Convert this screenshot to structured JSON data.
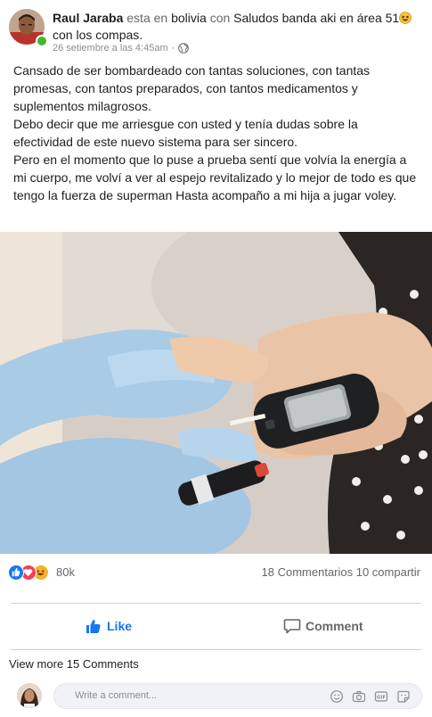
{
  "post": {
    "author": "Raul Jaraba",
    "location_connector": "esta en",
    "location": "bolivia",
    "with_connector": "con",
    "activity_line": "Saludos banda aki en área 51",
    "activity_tail": "con los compas.",
    "timestamp": "26 setiembre a las 4:45am",
    "dot": "·",
    "paragraphs": [
      "Cansado de ser bombardeado con tantas soluciones, con tantas promesas, con tantos preparados, con tantos medicamentos y suplementos milagrosos.",
      "Debo decir que me arriesgue con usted y tenía dudas sobre la efectividad de este nuevo sistema para ser sincero.",
      "Pero en el momento que lo puse a prueba sentí que volvía la energía a mi cuerpo, me volví a ver al espejo revitalizado y lo mejor de todo es que tengo la fuerza de superman Hasta acompaño a mi hija a jugar voley."
    ]
  },
  "reactions": {
    "count": "80k",
    "comments_shares": "18 Commentarios 10 compartir",
    "icons": [
      "like-icon",
      "love-icon",
      "haha-icon"
    ],
    "colors": {
      "like": "#1877f2",
      "love": "#f33e58",
      "haha": "#f7b125"
    }
  },
  "actions": {
    "like_label": "Like",
    "comment_label": "Comment"
  },
  "view_more": "View more 15 Comments",
  "comment_box": {
    "placeholder": "Write a comment..."
  },
  "colors": {
    "brand_blue": "#1877f2",
    "online_green": "#42b72a",
    "muted_text": "#65676b"
  }
}
